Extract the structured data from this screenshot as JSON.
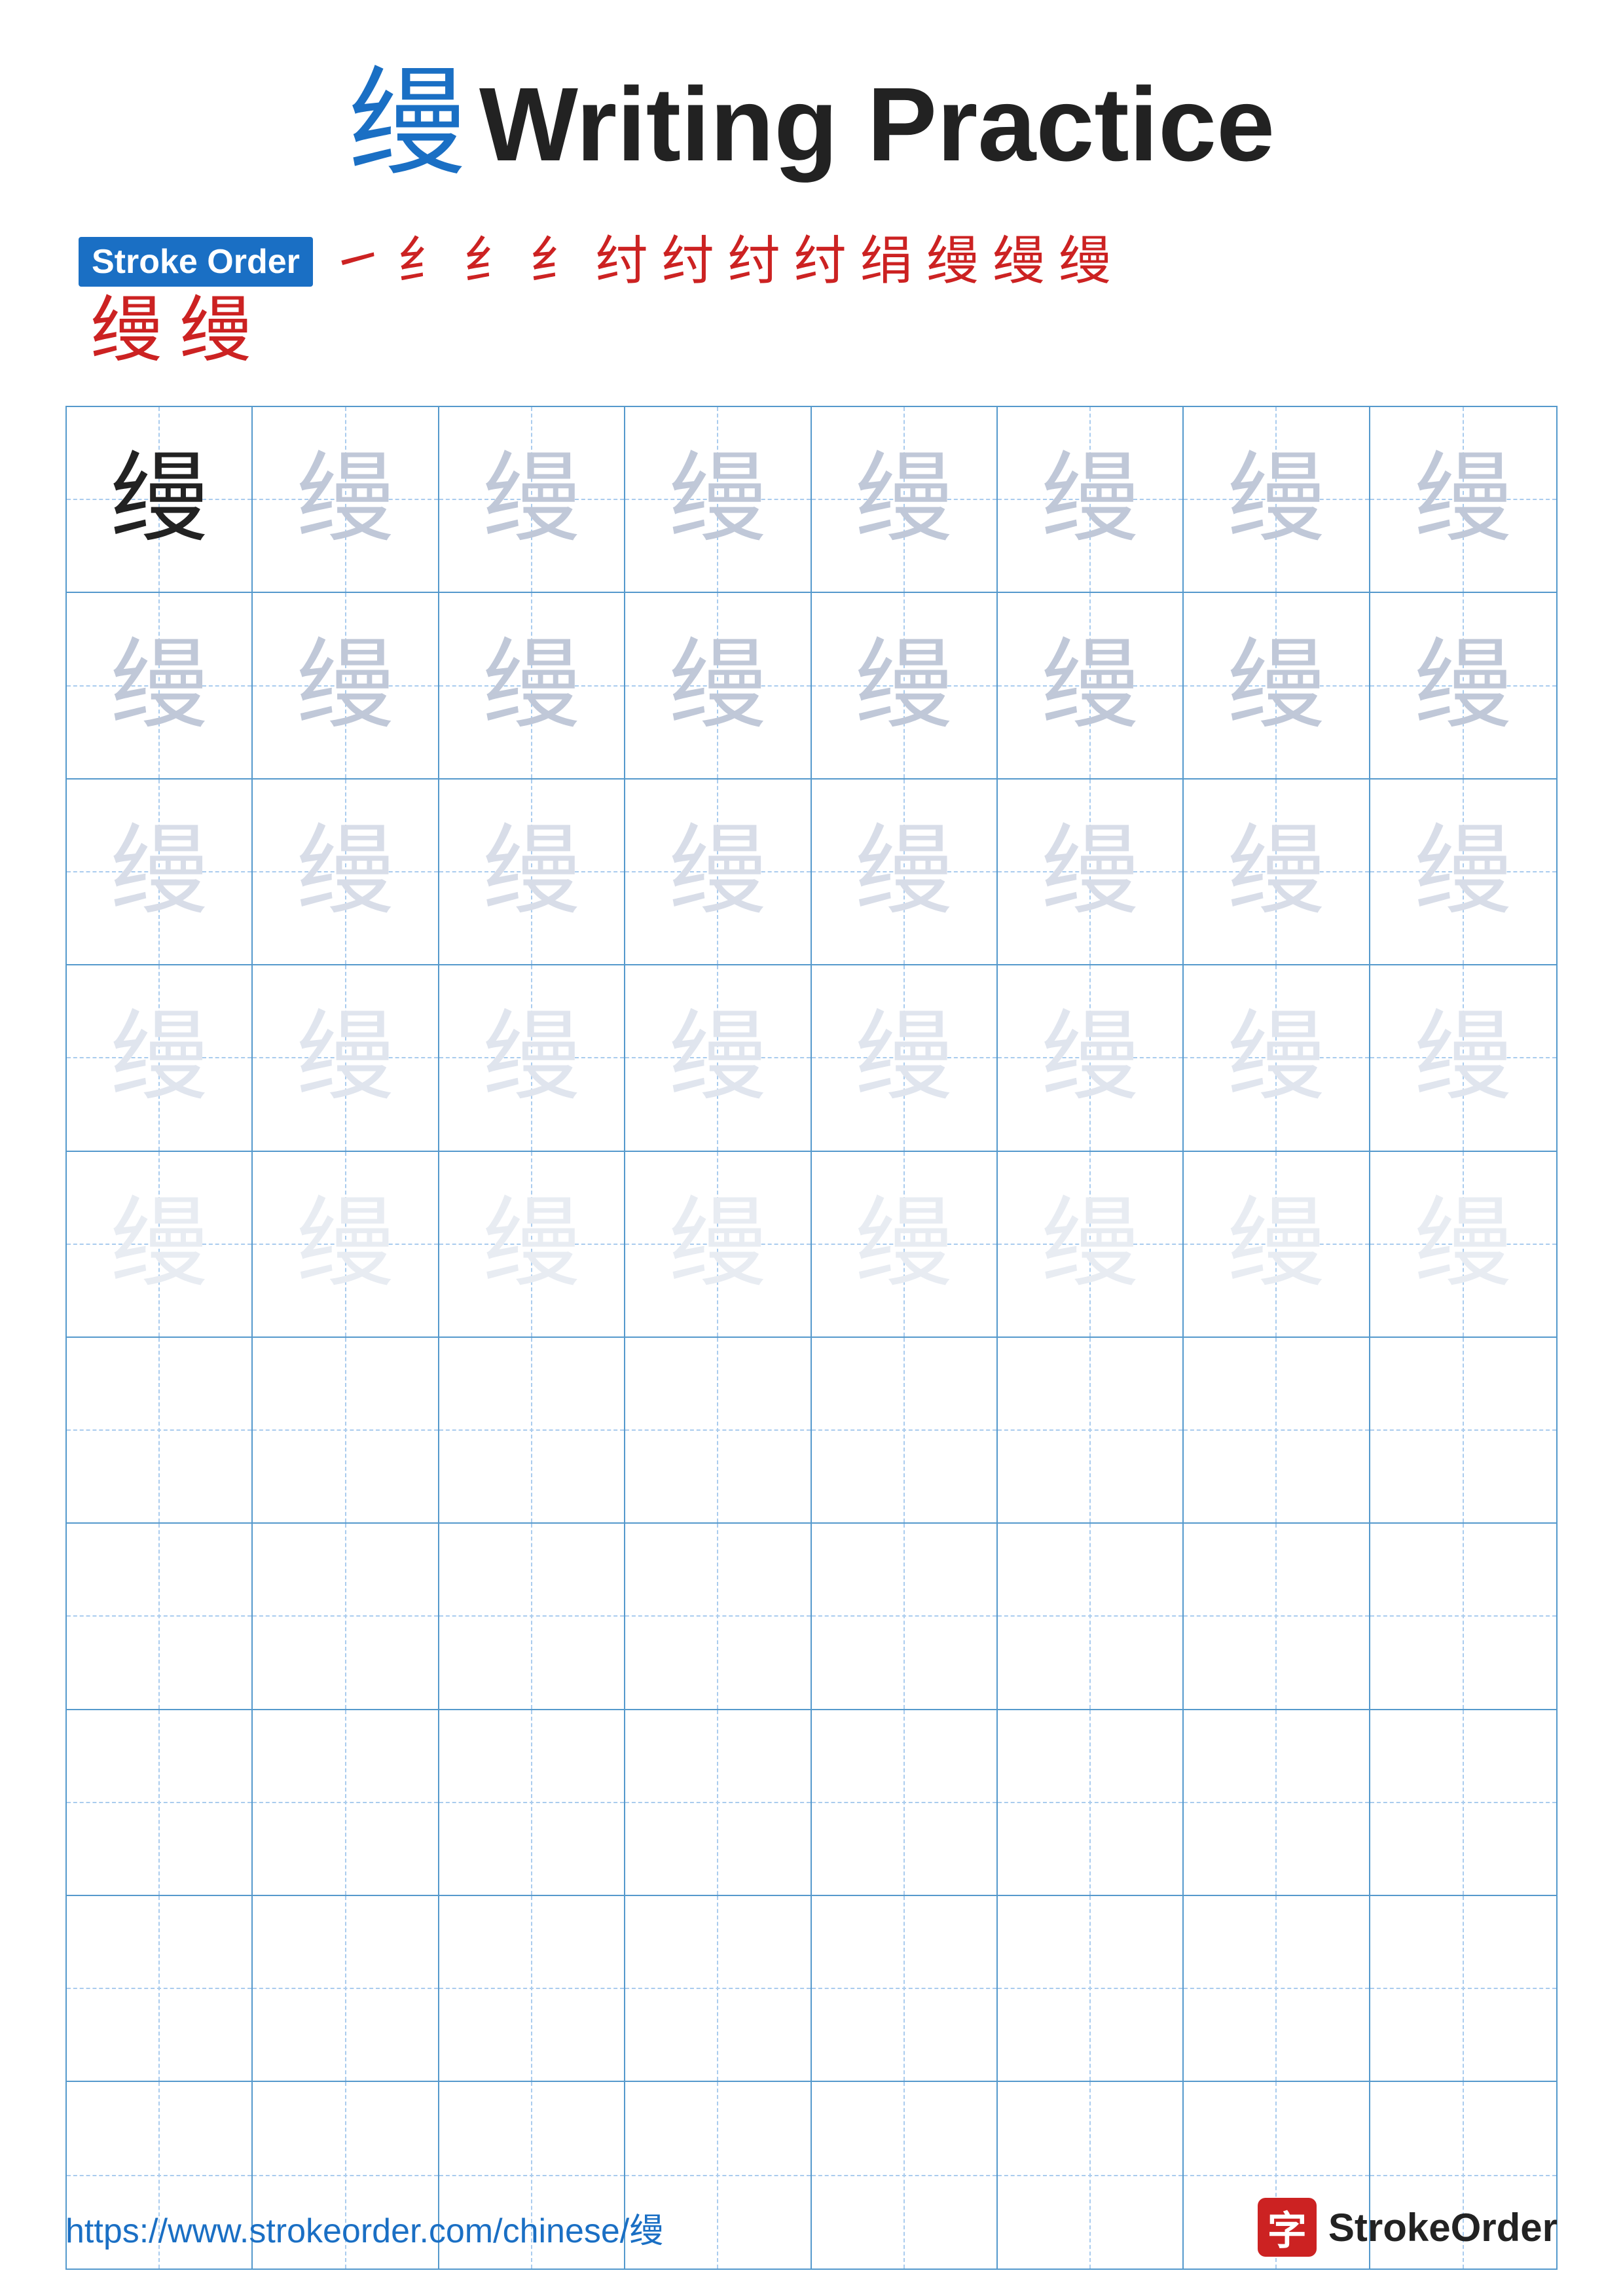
{
  "title": {
    "char": "缦",
    "text": "Writing Practice"
  },
  "stroke_order": {
    "label": "Stroke Order",
    "strokes": [
      "㇀",
      "纟",
      "纟",
      "纟",
      "纟",
      "纟",
      "纟",
      "纟",
      "绢",
      "缦",
      "缦",
      "缦"
    ],
    "row2": [
      "缦",
      "缦"
    ]
  },
  "grid": {
    "rows": 10,
    "cols": 8,
    "char": "缦",
    "filled_rows": 5
  },
  "footer": {
    "url": "https://www.strokeorder.com/chinese/缦",
    "brand": "StrokeOrder",
    "logo_char": "字"
  }
}
